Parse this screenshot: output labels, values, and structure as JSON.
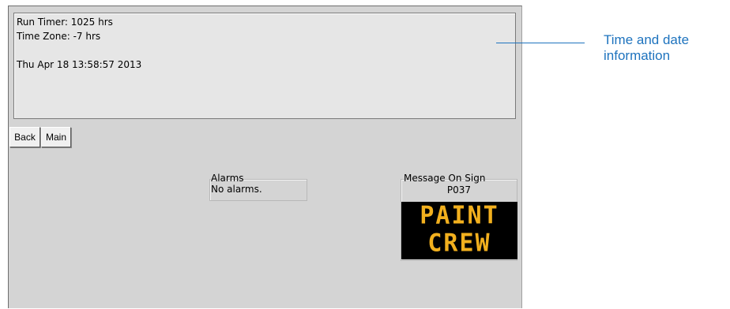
{
  "info": {
    "run_timer": "Run Timer: 1025 hrs",
    "time_zone": "Time Zone: -7 hrs",
    "datetime": "Thu Apr 18 13:58:57 2013"
  },
  "nav": {
    "back_label": "Back",
    "main_label": "Main"
  },
  "alarms": {
    "title": "Alarms",
    "status": "No alarms."
  },
  "message_sign": {
    "title": "Message On Sign",
    "code": "P037",
    "lines": [
      "PAINT",
      "CREW"
    ],
    "text_color": "#f2b01e",
    "background_color": "#000000"
  },
  "callout": {
    "line1": "Time and date",
    "line2": "information",
    "color": "#1e73be"
  }
}
